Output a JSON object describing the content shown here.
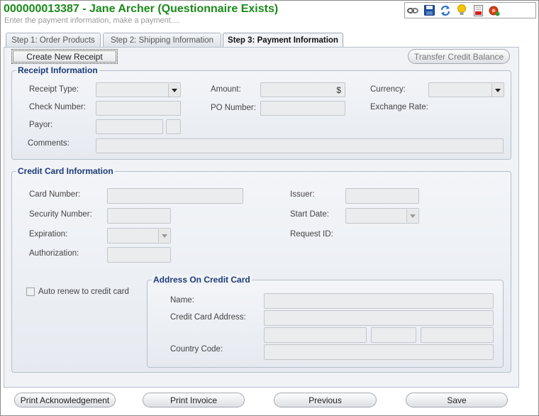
{
  "header": {
    "title": "000000013387 - Jane Archer (Questionnaire Exists)",
    "subtitle": "Enter the payment information, make a payment...."
  },
  "toolbar": {
    "icons": [
      "link-icon",
      "save-icon",
      "refresh-icon",
      "lightbulb-icon",
      "report-icon",
      "delete-icon"
    ]
  },
  "tabs": [
    {
      "label": "Step 1: Order Products",
      "active": false
    },
    {
      "label": "Step 2: Shipping Information",
      "active": false
    },
    {
      "label": "Step 3: Payment Information",
      "active": true
    }
  ],
  "actions": {
    "create_receipt": "Create New Receipt",
    "transfer_credit": "Transfer Credit Balance"
  },
  "receipt": {
    "legend": "Receipt Information",
    "receipt_type_label": "Receipt Type:",
    "amount_label": "Amount:",
    "amount_currency_symbol": "$",
    "currency_label": "Currency:",
    "check_number_label": "Check Number:",
    "po_number_label": "PO Number:",
    "exchange_rate_label": "Exchange Rate:",
    "payor_label": "Payor:",
    "comments_label": "Comments:"
  },
  "credit_card": {
    "legend": "Credit Card Information",
    "card_number_label": "Card Number:",
    "issuer_label": "Issuer:",
    "security_number_label": "Security Number:",
    "start_date_label": "Start Date:",
    "expiration_label": "Expiration:",
    "request_id_label": "Request ID:",
    "authorization_label": "Authorization:",
    "auto_renew_label": "Auto renew to credit card",
    "auto_renew_checked": false
  },
  "address": {
    "legend": "Address On Credit Card",
    "name_label": "Name:",
    "address_label": "Credit Card Address:",
    "country_code_label": "Country Code:"
  },
  "footer": {
    "print_ack": "Print Acknowledgement",
    "print_invoice": "Print Invoice",
    "previous": "Previous",
    "save": "Save"
  }
}
